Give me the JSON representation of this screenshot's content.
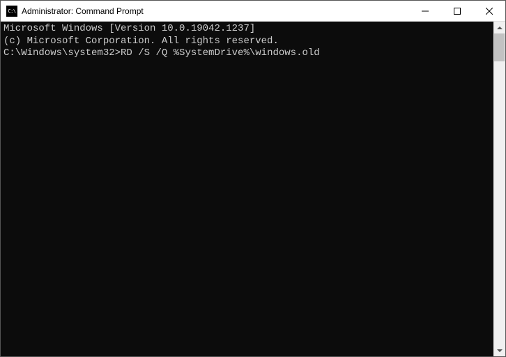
{
  "window": {
    "title": "Administrator: Command Prompt"
  },
  "terminal": {
    "line1": "Microsoft Windows [Version 10.0.19042.1237]",
    "line2": "(c) Microsoft Corporation. All rights reserved.",
    "blank": "",
    "prompt": "C:\\Windows\\system32>",
    "command": "RD /S /Q %SystemDrive%\\windows.old"
  }
}
